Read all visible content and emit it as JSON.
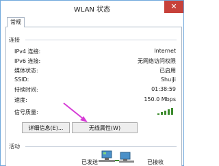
{
  "window": {
    "title": "WLAN 状态",
    "close_glyph": "✕"
  },
  "tab": {
    "label": "常规"
  },
  "connection": {
    "group_label": "连接",
    "rows": [
      {
        "label": "IPv4 连接:",
        "value": "Internet"
      },
      {
        "label": "IPv6 连接:",
        "value": "无网络访问权限"
      },
      {
        "label": "媒体状态:",
        "value": "已启用"
      },
      {
        "label": "SSID:",
        "value": "ShuiJi"
      },
      {
        "label": "持续时间:",
        "value": "01:38:59"
      },
      {
        "label": "速度:",
        "value": "150.0 Mbps"
      }
    ],
    "signal_label": "信号质量:",
    "signal_bars_total": 5,
    "signal_bars_active": 5,
    "signal_icon": "signal-strength-icon"
  },
  "buttons": {
    "details_label": "详细信息(E)...",
    "wireless_props_label": "无线属性(W)"
  },
  "activity": {
    "group_label": "活动",
    "sent_label": "已发送",
    "received_label": "已接收",
    "network_icon": "network-computers-icon"
  },
  "colors": {
    "close_button": "#c7413a",
    "annotation_arrow": "#d63bd6",
    "signal_green": "#3b8a2c",
    "border_blue": "#6fa8dc"
  }
}
